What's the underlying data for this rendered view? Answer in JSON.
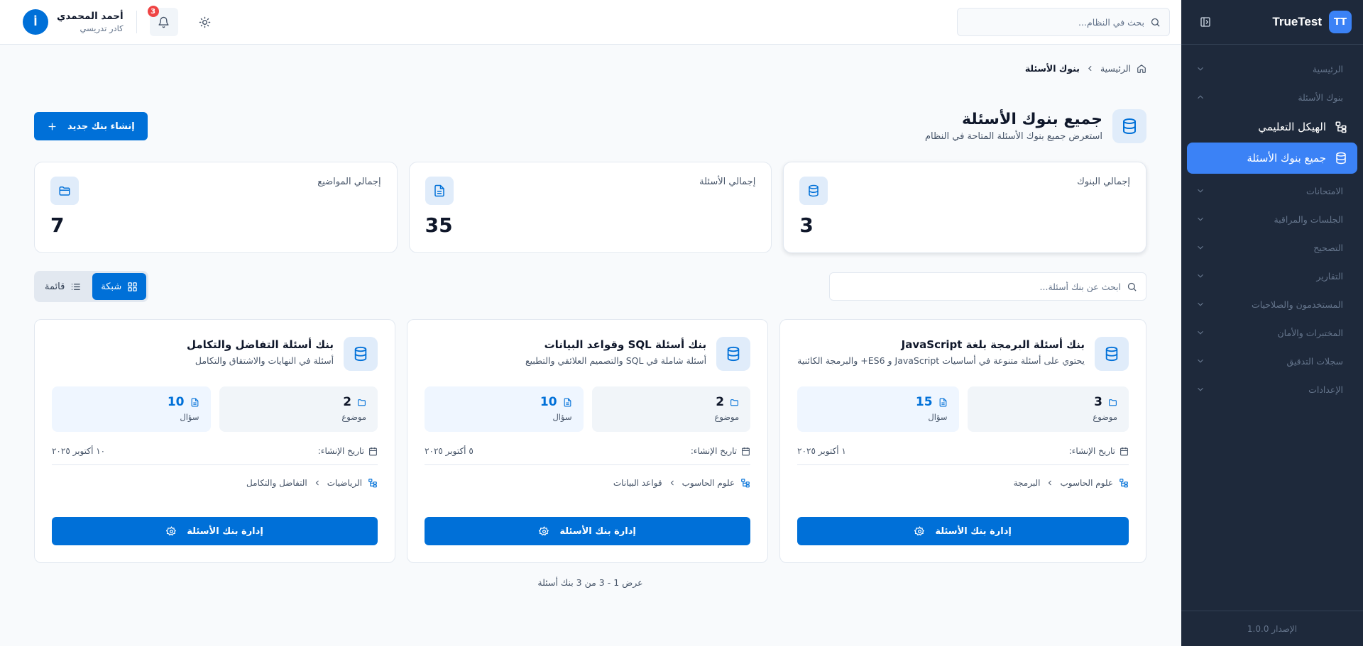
{
  "brand": {
    "logo_text": "TT",
    "name": "TrueTest"
  },
  "sidebar": {
    "sections": [
      {
        "label": "الرئيسية"
      },
      {
        "label": "بنوك الأسئلة",
        "expanded": true
      }
    ],
    "sub_items": [
      {
        "label": "الهيكل التعليمي",
        "icon": "hierarchy-icon"
      },
      {
        "label": "جميع بنوك الأسئلة",
        "icon": "database-icon",
        "active": true
      }
    ],
    "more_sections": [
      {
        "label": "الامتحانات"
      },
      {
        "label": "الجلسات والمراقبة"
      },
      {
        "label": "التصحيح"
      },
      {
        "label": "التقارير"
      },
      {
        "label": "المستخدمون والصلاحيات"
      },
      {
        "label": "المختبرات والأمان"
      },
      {
        "label": "سجلات التدقيق"
      },
      {
        "label": "الإعدادات"
      }
    ],
    "version": "الإصدار 1.0.0"
  },
  "topbar": {
    "search_placeholder": "بحث في النظام...",
    "notifications_count": "3",
    "user": {
      "initial": "أ",
      "name": "أحمد المحمدي",
      "role": "كادر تدريسي"
    }
  },
  "breadcrumb": {
    "home": "الرئيسية",
    "current": "بنوك الأسئلة"
  },
  "page": {
    "title": "جميع بنوك الأسئلة",
    "subtitle": "استعرض جميع بنوك الأسئلة المتاحة في النظام",
    "create_button": "إنشاء بنك جديد"
  },
  "stats": [
    {
      "label": "إجمالي البنوك",
      "value": "3",
      "icon": "database-icon"
    },
    {
      "label": "إجمالي الأسئلة",
      "value": "35",
      "icon": "document-icon"
    },
    {
      "label": "إجمالي المواضيع",
      "value": "7",
      "icon": "folder-icon"
    }
  ],
  "filters": {
    "search_placeholder": "ابحث عن بنك أسئلة...",
    "view_grid": "شبكة",
    "view_list": "قائمة"
  },
  "cards": [
    {
      "title": "بنك أسئلة البرمجة بلغة JavaScript",
      "description": "يحتوي على أسئلة متنوعة في أساسيات JavaScript و ES6+ والبرمجة الكائنية",
      "topics": "3",
      "topics_label": "موضوع",
      "questions": "15",
      "questions_label": "سؤال",
      "created_label": "تاريخ الإنشاء:",
      "created_date": "١ أكتوبر ٢٠٢٥",
      "path_1": "علوم الحاسوب",
      "path_2": "البرمجة",
      "button": "إدارة بنك الأسئلة"
    },
    {
      "title": "بنك أسئلة SQL وقواعد البيانات",
      "description": "أسئلة شاملة في SQL والتصميم العلائقي والتطبيع",
      "topics": "2",
      "topics_label": "موضوع",
      "questions": "10",
      "questions_label": "سؤال",
      "created_label": "تاريخ الإنشاء:",
      "created_date": "٥ أكتوبر ٢٠٢٥",
      "path_1": "علوم الحاسوب",
      "path_2": "قواعد البيانات",
      "button": "إدارة بنك الأسئلة"
    },
    {
      "title": "بنك أسئلة التفاضل والتكامل",
      "description": "أسئلة في النهايات والاشتقاق والتكامل",
      "topics": "2",
      "topics_label": "موضوع",
      "questions": "10",
      "questions_label": "سؤال",
      "created_label": "تاريخ الإنشاء:",
      "created_date": "١٠ أكتوبر ٢٠٢٥",
      "path_1": "الرياضيات",
      "path_2": "التفاضل والتكامل",
      "button": "إدارة بنك الأسئلة"
    }
  ],
  "pagination": {
    "text": "عرض 1 - 3 من 3 بنك أسئلة"
  },
  "colors": {
    "primary": "#0070d8",
    "sidebar_bg": "#1e293b",
    "sidebar_active": "#3b82f6",
    "badge": "#ef4444"
  }
}
